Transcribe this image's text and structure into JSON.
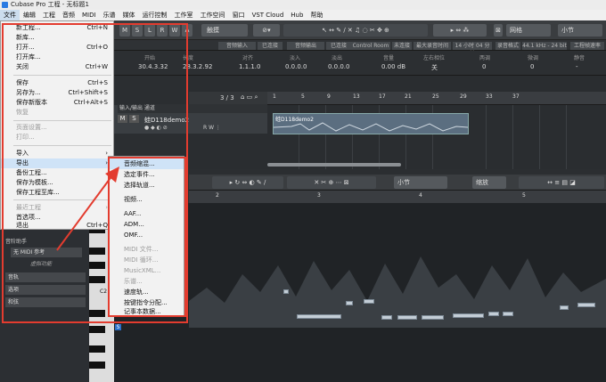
{
  "window": {
    "title": "Cubase Pro 工程 - 无标题1"
  },
  "menubar": {
    "items": [
      "文件",
      "编辑",
      "工程",
      "音频",
      "MIDI",
      "乐谱",
      "媒体",
      "运行控制",
      "工作室",
      "工作空间",
      "窗口",
      "VST Cloud",
      "Hub",
      "帮助"
    ]
  },
  "toolbar": {
    "mode_buttons": [
      "M",
      "S",
      "L",
      "R",
      "W",
      "A"
    ],
    "touch_label": "触摸",
    "grid_label": "网格",
    "grid_value": "小节"
  },
  "status_bar": {
    "cells": [
      "音频输入",
      "已连接",
      "音频输出",
      "已连接",
      "Control Room",
      "未连接",
      "最大录音时间",
      "14 小时 04 分钟",
      "录音格式",
      "44.1 kHz - 24 bit",
      "工程帧速率"
    ]
  },
  "info_line": {
    "headers": [
      "开始",
      "长度",
      "对齐",
      "淡入",
      "淡出",
      "音量",
      "左右相位",
      "两调",
      "微调",
      "静音"
    ],
    "values": [
      "30.4.3.32",
      "28.3.2.92",
      "1.1.1.0",
      "0.0.0.0",
      "0.0.0.0",
      "0.00 dB",
      "关",
      "0",
      "0",
      "-"
    ]
  },
  "project": {
    "track_count": "3 / 3",
    "track_header_label": "输入/输出 通道",
    "track_name": "蛙D118demo2",
    "clip_name": "蛙D118demo2",
    "ruler": [
      "1",
      "5",
      "9",
      "13",
      "17",
      "21",
      "25",
      "29",
      "33",
      "37"
    ]
  },
  "left_panel": {
    "items": [
      "音阶助手",
      "无 MIDI 参考",
      "虚拟功能",
      "音轨",
      "选项",
      "和弦"
    ]
  },
  "lower_editor": {
    "grid_value": "小节",
    "zoom_label": "缩放",
    "ruler": [
      "2",
      "3",
      "4",
      "5"
    ],
    "piano_label": "C2",
    "marker": "S"
  },
  "file_menu": {
    "items": [
      {
        "label": "新工程...",
        "shortcut": "Ctrl+N"
      },
      {
        "label": "新库..."
      },
      {
        "label": "打开...",
        "shortcut": "Ctrl+O"
      },
      {
        "label": "打开库..."
      },
      {
        "label": "关闭",
        "shortcut": "Ctrl+W"
      },
      {
        "label": "保存",
        "shortcut": "Ctrl+S"
      },
      {
        "label": "另存为...",
        "shortcut": "Ctrl+Shift+S"
      },
      {
        "label": "保存新版本",
        "shortcut": "Ctrl+Alt+S"
      },
      {
        "label": "恢复"
      },
      {
        "label": "页面设置..."
      },
      {
        "label": "打印..."
      },
      {
        "label": "导入"
      },
      {
        "label": "导出"
      },
      {
        "label": "备份工程..."
      },
      {
        "label": "保存为模板..."
      },
      {
        "label": "保存工程至库..."
      },
      {
        "label": "最近工程"
      },
      {
        "label": "首选项..."
      },
      {
        "label": "退出",
        "shortcut": "Ctrl+Q"
      }
    ]
  },
  "export_submenu": {
    "items": [
      "音频缩混...",
      "选定事件...",
      "选择轨道...",
      "视频...",
      "AAF...",
      "ADM...",
      "OMF...",
      "MIDI 文件...",
      "MIDI 循环...",
      "MusicXML...",
      "乐谱...",
      "速度轨...",
      "按键指令分配...",
      "记事本数据..."
    ]
  },
  "colors": {
    "annotation_red": "#e33c2f",
    "menu_bg": "#f2f2f2",
    "highlight": "#cfe3f7"
  }
}
